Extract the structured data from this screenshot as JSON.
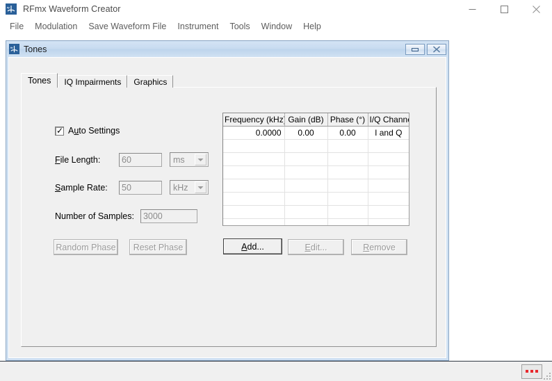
{
  "app": {
    "title": "RFmx Waveform Creator",
    "icon": "waveform-icon",
    "window_buttons": [
      {
        "name": "minimize",
        "glyph": "minimize-icon"
      },
      {
        "name": "maximize",
        "glyph": "maximize-icon"
      },
      {
        "name": "close",
        "glyph": "close-icon"
      }
    ]
  },
  "menubar": {
    "items": [
      {
        "label": "File"
      },
      {
        "label": "Modulation"
      },
      {
        "label": "Save Waveform File"
      },
      {
        "label": "Instrument"
      },
      {
        "label": "Tools"
      },
      {
        "label": "Window"
      },
      {
        "label": "Help"
      }
    ]
  },
  "child_window": {
    "title": "Tones",
    "icon": "waveform-icon",
    "buttons": [
      {
        "name": "minimize",
        "glyph": "minimize-icon"
      },
      {
        "name": "close",
        "glyph": "close-icon"
      }
    ]
  },
  "tabs": [
    {
      "label": "Tones",
      "active": true
    },
    {
      "label": "IQ Impairments",
      "active": false
    },
    {
      "label": "Graphics",
      "active": false
    }
  ],
  "form": {
    "auto_settings": {
      "label_pre": "A",
      "label_accel": "u",
      "label_post": "to Settings",
      "label": "Auto Settings",
      "checked": true
    },
    "file_length": {
      "label_accel": "F",
      "label_post": "ile Length:",
      "value": "60",
      "unit": "ms",
      "enabled": false
    },
    "sample_rate": {
      "label_accel": "S",
      "label_post": "ample Rate:",
      "value": "50",
      "unit": "kHz",
      "enabled": false
    },
    "number_of_samples": {
      "label": "Number of Samples:",
      "value": "3000",
      "enabled": false
    },
    "random_phase_button": {
      "label": "Random Phase",
      "enabled": false
    },
    "reset_phase_button": {
      "label": "Reset Phase",
      "enabled": false
    }
  },
  "grid": {
    "columns": [
      "Frequency (kHz)",
      "Gain (dB)",
      "Phase (°)",
      "I/Q Channel"
    ],
    "rows": [
      [
        "0.0000",
        "0.00",
        "0.00",
        "I and Q"
      ]
    ],
    "empty_row_count": 7
  },
  "grid_buttons": {
    "add": {
      "accel": "A",
      "rest": "dd...",
      "label": "Add...",
      "enabled": true,
      "default": true
    },
    "edit": {
      "accel": "E",
      "rest": "dit...",
      "label": "Edit...",
      "enabled": false
    },
    "remove": {
      "accel": "R",
      "rest": "emove",
      "label": "Remove",
      "enabled": false
    }
  },
  "statusbar": {
    "indicator_panel": {
      "name": "led-indicator-panel",
      "led_count": 3,
      "led_color": "#e8282d"
    },
    "resize_grip": "resize-grip"
  },
  "colors": {
    "accent": "#2a6099",
    "child_border": "#8ba6c4",
    "face": "#f0f0f0",
    "led": "#e8282d"
  }
}
